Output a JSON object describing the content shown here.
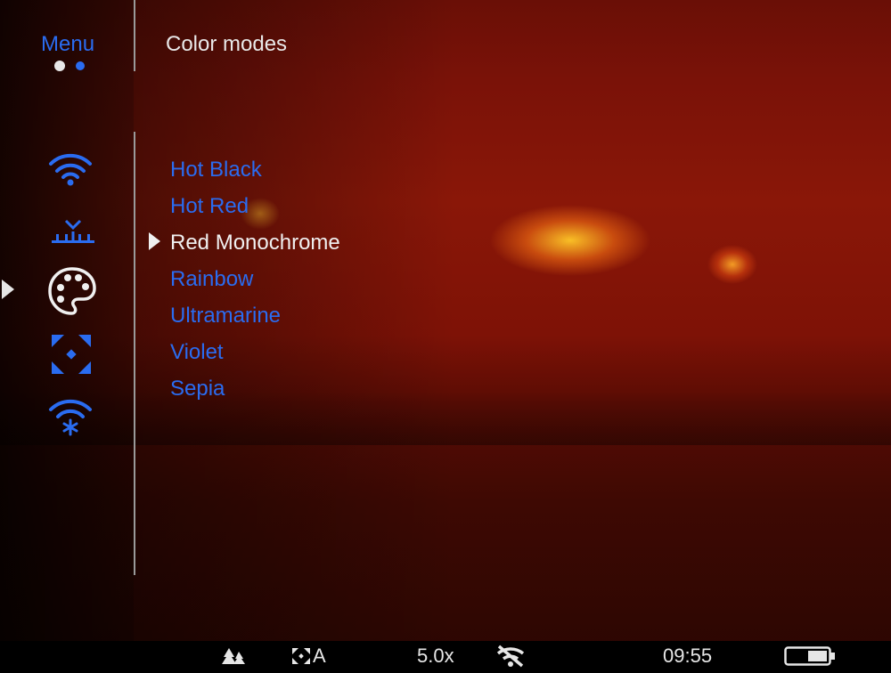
{
  "menu": {
    "title": "Menu"
  },
  "section": {
    "title": "Color modes"
  },
  "sidebar": {
    "items": [
      {
        "icon": "wifi-icon"
      },
      {
        "icon": "calibration-icon"
      },
      {
        "icon": "palette-icon",
        "selected": true
      },
      {
        "icon": "crosshair-icon"
      },
      {
        "icon": "wifi-settings-icon"
      }
    ]
  },
  "color_modes": {
    "options": [
      "Hot Black",
      "Hot Red",
      "Red Monochrome",
      "Rainbow",
      "Ultramarine",
      "Violet",
      "Sepia"
    ],
    "selected": "Red Monochrome"
  },
  "status": {
    "mode_icon": "forest-mode-icon",
    "calibration_label": "A",
    "zoom": "5.0x",
    "wifi_off_icon": "wifi-off-icon",
    "time": "09:55",
    "battery_icon": "battery-icon"
  },
  "colors": {
    "accent": "#2a6cf0",
    "text": "#e8e8e8"
  }
}
